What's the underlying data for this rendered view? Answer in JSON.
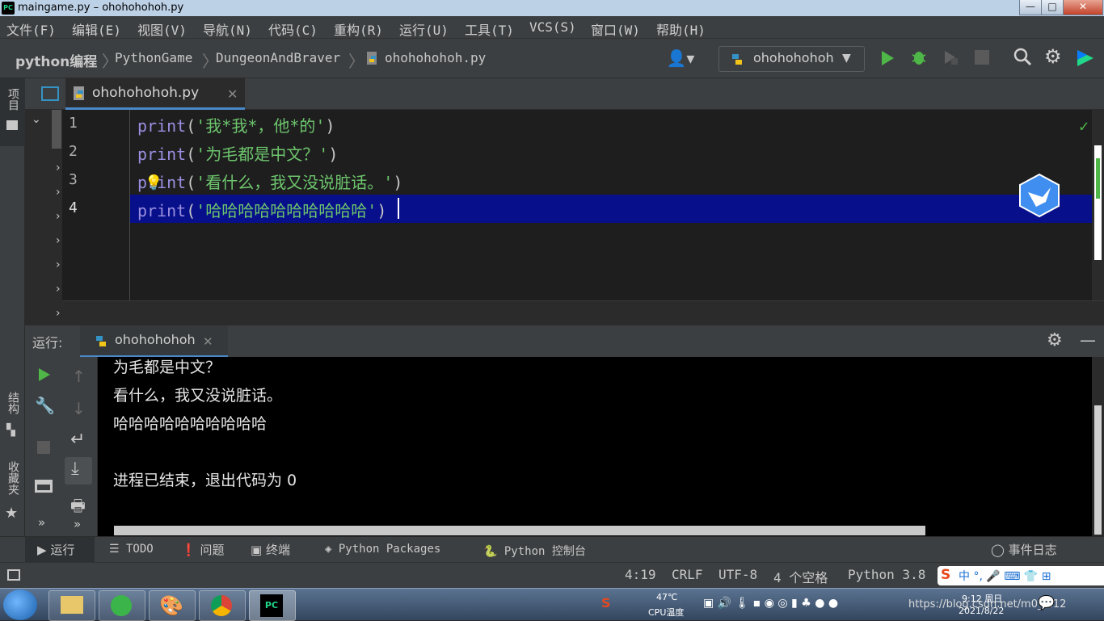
{
  "window": {
    "title": "maingame.py – ohohohohoh.py",
    "app_badge": "PC",
    "controls": [
      "—",
      "□",
      "✕"
    ]
  },
  "menu": [
    "文件(F)",
    "编辑(E)",
    "视图(V)",
    "导航(N)",
    "代码(C)",
    "重构(R)",
    "运行(U)",
    "工具(T)",
    "VCS(S)",
    "窗口(W)",
    "帮助(H)"
  ],
  "breadcrumb": [
    "python编程",
    "PythonGame",
    "DungeonAndBraver",
    "ohohohohoh.py"
  ],
  "toolbar": {
    "run_config": "ohohohohoh",
    "colors": {
      "run": "#4eb748",
      "debug": "#4eb748",
      "accent": "#3592c4"
    }
  },
  "sidebar": {
    "project_tab": "项目",
    "structure_tab": "结构",
    "favorites_tab": "收藏夹"
  },
  "editor": {
    "tab_label": "ohohohohoh.py",
    "lines": [
      {
        "num": "1",
        "kw": "print",
        "open": "(",
        "str": "'我*我*，他*的'",
        "close": ")"
      },
      {
        "num": "2",
        "kw": "print",
        "open": "(",
        "str": "'为毛都是中文？'",
        "close": ")"
      },
      {
        "num": "3",
        "kw": "print",
        "open": "(",
        "str": "'看什么，我又没说脏话。'",
        "close": ")"
      },
      {
        "num": "4",
        "kw": "print",
        "open": "(",
        "str": "'哈哈哈哈哈哈哈哈哈哈'",
        "close": ")"
      }
    ],
    "current_line": 4
  },
  "run_panel": {
    "label": "运行:",
    "tab": "ohohohohoh",
    "output": [
      "为毛都是中文？",
      "看什么，我又没说脏话。",
      "哈哈哈哈哈哈哈哈哈哈",
      "",
      "进程已结束，退出代码为 0"
    ]
  },
  "bottom_tabs": [
    "运行",
    "TODO",
    "问题",
    "终端",
    "Python Packages",
    "Python 控制台"
  ],
  "event_log": "事件日志",
  "status": {
    "position": "4:19",
    "line_sep": "CRLF",
    "encoding": "UTF-8",
    "indent": "4 个空格",
    "interpreter": "Python 3.8"
  },
  "taskbar": {
    "temp": "47℃",
    "cpu_label": "CPU温度",
    "time": "9:12 周日",
    "date": "2021/8/22",
    "watermark": "https://blog.csdn.net/m0_...12"
  }
}
